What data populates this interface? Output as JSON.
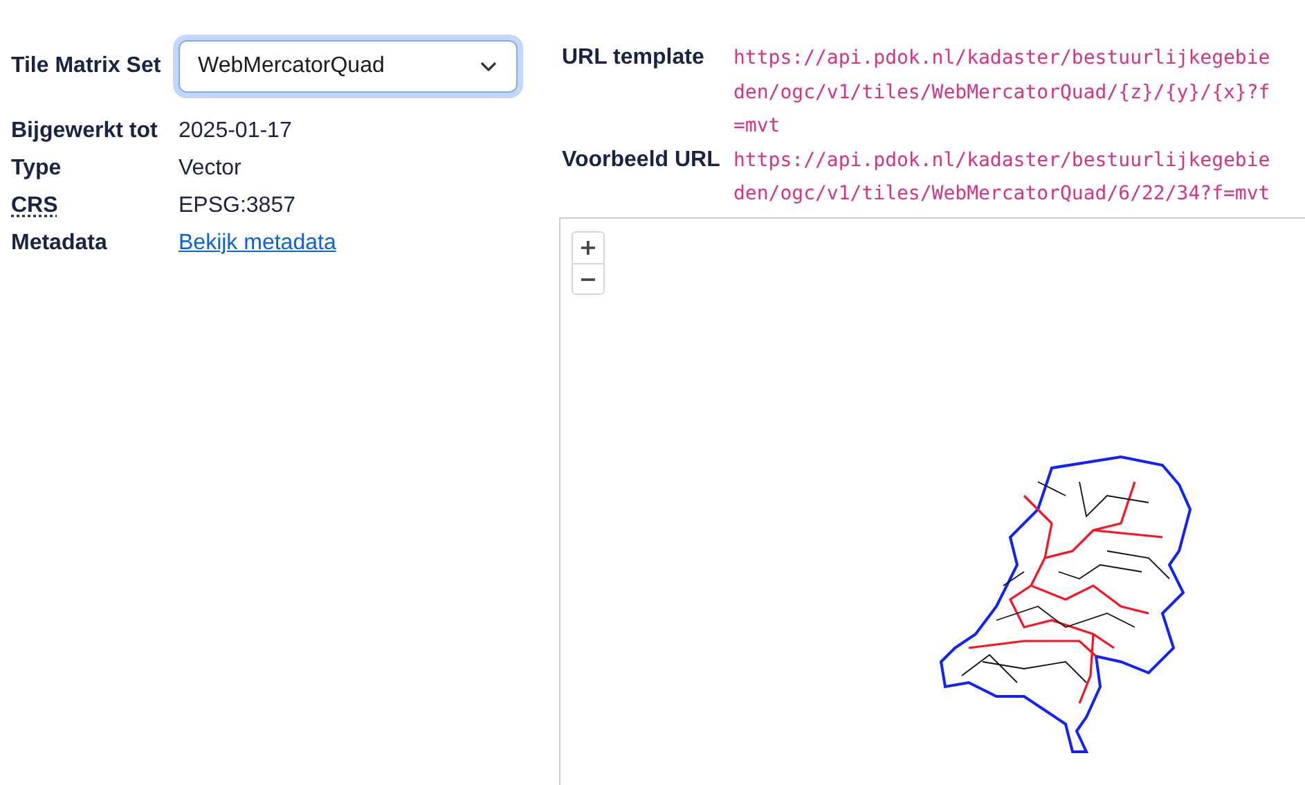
{
  "properties": [
    {
      "label": "Tile Matrix Set",
      "kind": "select",
      "value": "WebMercatorQuad"
    },
    {
      "label": "Bijgewerkt tot",
      "kind": "text",
      "value": "2025-01-17"
    },
    {
      "label": "Type",
      "kind": "text",
      "value": "Vector"
    },
    {
      "label": "CRS",
      "kind": "abbr",
      "value": "EPSG:3857"
    },
    {
      "label": "Metadata",
      "kind": "link",
      "value": "Bekijk metadata"
    }
  ],
  "urls": [
    {
      "label": "URL template",
      "value": "https://api.pdok.nl/kadaster/bestuurlijkegebieden/ogc/v1/tiles/WebMercatorQuad/{z}/{y}/{x}?f=mvt"
    },
    {
      "label": "Voorbeeld URL",
      "value": "https://api.pdok.nl/kadaster/bestuurlijkegebieden/ogc/v1/tiles/WebMercatorQuad/6/22/34?f=mvt"
    }
  ],
  "map": {
    "zoom_in": "+",
    "zoom_out": "−"
  }
}
